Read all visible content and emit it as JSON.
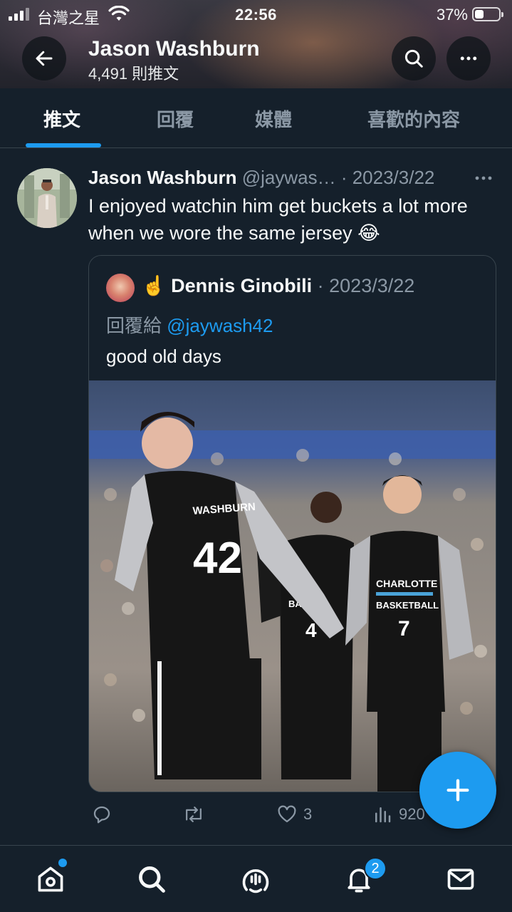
{
  "status_bar": {
    "carrier": "台灣之星",
    "time": "22:56",
    "battery_percent": "37%",
    "battery_level": 0.37
  },
  "header": {
    "profile_name": "Jason Washburn",
    "tweet_count": "4,491 則推文",
    "back_icon": "arrow-left-icon",
    "search_icon": "search-icon",
    "more_icon": "more-icon"
  },
  "tabs": [
    {
      "label": "推文",
      "active": true
    },
    {
      "label": "回覆",
      "active": false
    },
    {
      "label": "媒體",
      "active": false
    },
    {
      "label": "喜歡的內容",
      "active": false
    }
  ],
  "tweet": {
    "author_name": "Jason Washburn",
    "handle_date": "@jaywas… · 2023/3/22",
    "text": "I enjoyed watchin him get buckets a lot more when we wore the same jersey 😂",
    "quote": {
      "author_prefix": "☝️",
      "author_name": "Dennis Ginobili",
      "date": " · 2023/3/22",
      "reply_to_label": "回覆給 ",
      "reply_to_handle": "@jaywash42",
      "text": "good old days",
      "photo": {
        "jersey_left_name": "WASHBURN",
        "jersey_left_number": "42",
        "jersey_right_team": "CHARLOTTE",
        "jersey_right_team2": "BASKETBALL",
        "jersey_right_number": "7",
        "jersey_mid_text": "BASKE",
        "jersey_mid_number": "4"
      }
    },
    "actions": {
      "reply_count": "",
      "retweet_count": "",
      "like_count": "3",
      "views_count": "920"
    }
  },
  "bottom_nav": {
    "notification_badge": "2",
    "accent_color": "#1d9bf0"
  }
}
